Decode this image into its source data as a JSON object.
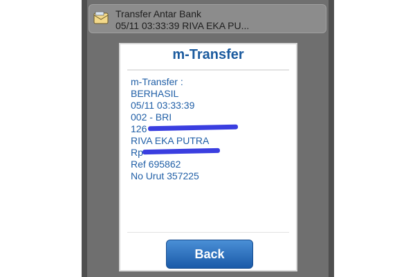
{
  "notification": {
    "title": "Transfer Antar Bank",
    "text": "05/11 03:33:39 RIVA EKA PU...",
    "icon": "envelope-icon"
  },
  "dialog": {
    "title": "m-Transfer",
    "lines": [
      "m-Transfer :",
      "BERHASIL",
      "05/11 03:33:39",
      "002 - BRI",
      "126",
      "RIVA EKA PUTRA",
      "Rp",
      "Ref 695862",
      "No Urut 357225"
    ],
    "back_label": "Back"
  },
  "colors": {
    "accent": "#1a5a9e",
    "button": "#1a5aa8",
    "redaction": "#3a3ee0"
  }
}
